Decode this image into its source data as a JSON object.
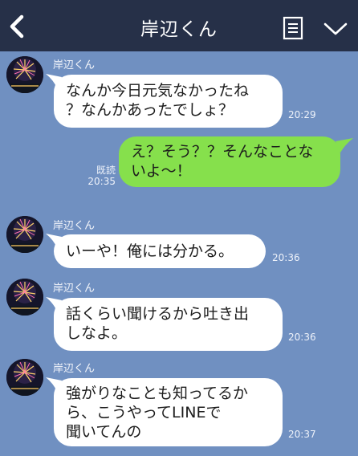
{
  "header": {
    "title": "岸辺くん",
    "back_icon": "chevron-left-icon",
    "menu_icon": "notes-list-icon",
    "collapse_icon": "chevron-down-icon",
    "background": "#263048"
  },
  "chat_background": "#7090c1",
  "messages": [
    {
      "direction": "incoming",
      "sender": "岸辺くん",
      "lines": [
        "なんか今日元気なかったね",
        "？なんかあったでしょ？"
      ],
      "time": "20:29"
    },
    {
      "direction": "outgoing",
      "lines": [
        "え？そう？？そんなことな",
        "いよ～！"
      ],
      "read_label": "既読",
      "time": "20:35"
    },
    {
      "direction": "incoming",
      "sender": "岸辺くん",
      "lines": [
        "いーや！俺には分かる。"
      ],
      "time": "20:36"
    },
    {
      "direction": "incoming",
      "sender": "岸辺くん",
      "lines": [
        "話くらい聞けるから吐き出",
        "しなよ。"
      ],
      "time": "20:36"
    },
    {
      "direction": "incoming",
      "sender": "岸辺くん",
      "lines": [
        "強がりなことも知ってるか",
        "ら、こうやってLINEで",
        "聞いてんの"
      ],
      "time": "20:37"
    }
  ],
  "colors": {
    "incoming_bubble": "#ffffff",
    "outgoing_bubble": "#86e04c"
  }
}
